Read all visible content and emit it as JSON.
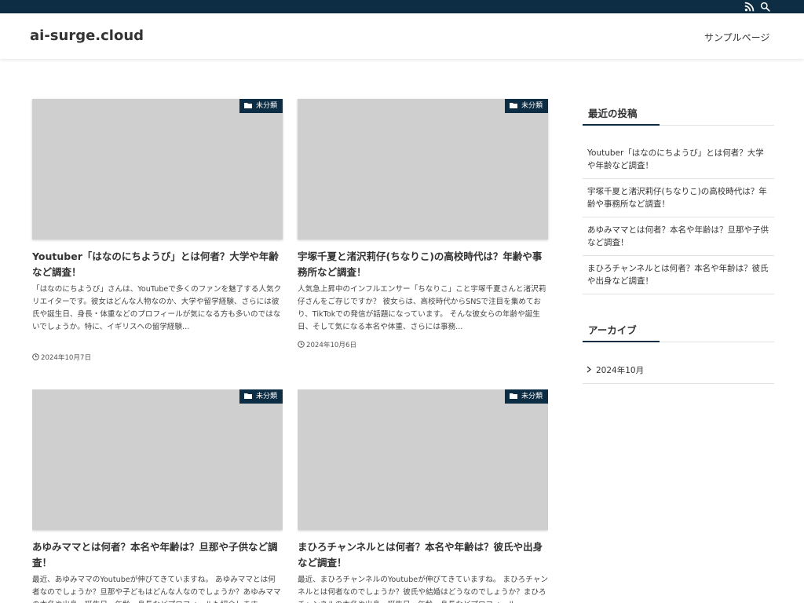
{
  "colors": {
    "navy": "#0d2d44",
    "thumb_gray": "#cfcfcf",
    "border": "#e2e2e2"
  },
  "topbar": {
    "icons": [
      "rss-icon",
      "search-icon"
    ]
  },
  "header": {
    "site_title": "ai-surge.cloud",
    "nav": [
      {
        "label": "サンプルページ"
      }
    ]
  },
  "posts": [
    {
      "category": "未分類",
      "title": "Youtuber「はなのにちようび」とは何者？大学や年齢など調査！",
      "excerpt": "「はなのにちようび」さんは、YouTubeで多くのファンを魅了する人気クリエイターです。彼女はどんな人物なのか、大学や留学経験、さらには彼氏や誕生日、身長・体重などのプロフィールが気になる方も多いのではないでしょうか。特に、イギリスへの留学経験...",
      "date": "2024年10月7日"
    },
    {
      "category": "未分類",
      "title": "宇塚千夏と渚沢莉仔(ちなりこ)の高校時代は？年齢や事務所など調査！",
      "excerpt": "人気急上昇中のインフルエンサー「ちなりこ」こと宇塚千夏さんと渚沢莉仔さんをご存じですか？ 彼女らは、高校時代からSNSで注目を集めており、TikTokでの発信が話題になっています。 そんな彼女らの年齢や誕生日、そして気になる本名や体重、さらには事務...",
      "date": "2024年10月6日"
    },
    {
      "category": "未分類",
      "title": "あゆみママとは何者？本名や年齢は？旦那や子供など調査！",
      "excerpt": "最近、あゆみママのYoutubeが伸びてきていますね。 あゆみママとは何者なのでしょうか？旦那や子どもはどんな人なのでしょうか？あゆみママの本名や出身、誕生日、年齢、身長などプロフィールも紹介します...",
      "date": ""
    },
    {
      "category": "未分類",
      "title": "まひろチャンネルとは何者？本名や年齢は？彼氏や出身など調査！",
      "excerpt": "最近、まひろチャンネルのYoutubeが伸びてきていますね。 まひろチャンネルとは何者なのでしょうか？彼氏や結婚はどうなのでしょうか？まひろチャンネルの本名や出身、誕生日、年齢、身長などプロフィール...",
      "date": ""
    }
  ],
  "sidebar": {
    "recent_title": "最近の投稿",
    "recent": [
      "Youtuber「はなのにちようび」とは何者？大学や年齢など調査！",
      "宇塚千夏と渚沢莉仔(ちなりこ)の高校時代は？年齢や事務所など調査！",
      "あゆみママとは何者？本名や年齢は？旦那や子供など調査！",
      "まひろチャンネルとは何者？本名や年齢は？彼氏や出身など調査！"
    ],
    "archive_title": "アーカイブ",
    "archives": [
      "2024年10月"
    ]
  }
}
